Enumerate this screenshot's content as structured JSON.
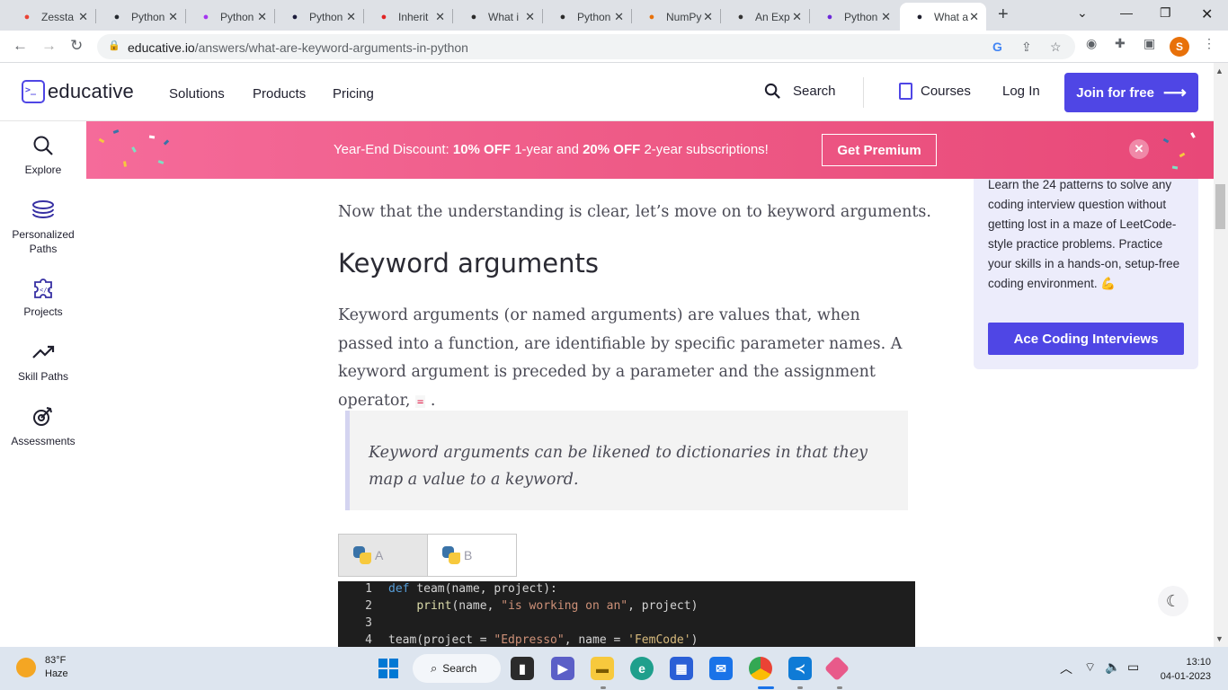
{
  "browser": {
    "tabs": [
      {
        "title": "Zessta",
        "favicon": "gmail-icon",
        "color": "#ea4335"
      },
      {
        "title": "Python",
        "favicon": "github-icon",
        "color": "#24292f"
      },
      {
        "title": "Python",
        "favicon": "udemy-icon",
        "color": "#a435f0"
      },
      {
        "title": "Python",
        "favicon": "codesignal-icon",
        "color": "#1c1c3c"
      },
      {
        "title": "Inherit",
        "favicon": "vertex-icon",
        "color": "#e02424"
      },
      {
        "title": "What i",
        "favicon": "diamond-icon",
        "color": "#2b2b2b"
      },
      {
        "title": "Python",
        "favicon": "diamond-icon",
        "color": "#2b2b2b"
      },
      {
        "title": "NumPy",
        "favicon": "slashes-icon",
        "color": "#e8710a"
      },
      {
        "title": "An Exp",
        "favicon": "chart-icon",
        "color": "#333"
      },
      {
        "title": "Python",
        "favicon": "p-icon",
        "color": "#6d28d9"
      },
      {
        "title": "What a",
        "favicon": "educative-icon",
        "color": "#1f1f2e"
      }
    ],
    "url": {
      "host": "educative.io",
      "path": "/answers/what-are-keyword-arguments-in-python"
    },
    "profile_initial": "S"
  },
  "header": {
    "brand": "educative",
    "nav": [
      "Solutions",
      "Products",
      "Pricing"
    ],
    "search": "Search",
    "courses": "Courses",
    "login": "Log In",
    "join": "Join for free"
  },
  "sidebar": {
    "items": [
      {
        "label": "Explore",
        "icon": "search-icon"
      },
      {
        "label": "Personalized Paths",
        "icon": "layers-icon"
      },
      {
        "label": "Projects",
        "icon": "puzzle-icon"
      },
      {
        "label": "Skill Paths",
        "icon": "trend-icon"
      },
      {
        "label": "Assessments",
        "icon": "target-icon"
      }
    ]
  },
  "banner": {
    "lead": "Year-End Discount: ",
    "b1": "10% OFF",
    "mid": " 1-year and ",
    "b2": "20% OFF",
    "tail": " 2-year subscriptions!",
    "cta": "Get Premium"
  },
  "article": {
    "intro": "Now that the understanding is clear, let’s move on to keyword arguments.",
    "heading": "Keyword arguments",
    "para": "Keyword arguments (or named arguments) are values that, when passed into a function, are identifiable by specific parameter names. A keyword argument is preceded by a parameter and the assignment operator,",
    "operator": "=",
    "para_end": ".",
    "quote": "Keyword arguments can be likened to dictionaries in that they map a value to a keyword.",
    "code_tabs": [
      "A",
      "B"
    ],
    "code": [
      {
        "n": "1",
        "parts": [
          [
            "kw",
            "def"
          ],
          [
            "",
            " "
          ],
          [
            "",
            "team(name, project):"
          ]
        ]
      },
      {
        "n": "2",
        "parts": [
          [
            "",
            "    "
          ],
          [
            "fn",
            "print"
          ],
          [
            "",
            "(name, "
          ],
          [
            "str",
            "\"is working on an\""
          ],
          [
            "",
            ", project)"
          ]
        ]
      },
      {
        "n": "3",
        "parts": []
      },
      {
        "n": "4",
        "parts": [
          [
            "",
            "team(project = "
          ],
          [
            "str",
            "\"Edpresso\""
          ],
          [
            "",
            ", name = "
          ],
          [
            "str2",
            "'FemCode'"
          ],
          [
            "",
            ")"
          ]
        ]
      }
    ]
  },
  "promo_card": {
    "text": "Learn the 24 patterns to solve any coding interview question without getting lost in a maze of LeetCode-style practice problems. Practice your skills in a hands-on, setup-free coding environment. 💪",
    "button": "Ace Coding Interviews"
  },
  "taskbar": {
    "weather_temp": "83°F",
    "weather_desc": "Haze",
    "search": "Search",
    "time": "13:10",
    "date": "04-01-2023"
  },
  "colors": {
    "accent": "#4f46e5",
    "banner": "#ee5a86"
  }
}
